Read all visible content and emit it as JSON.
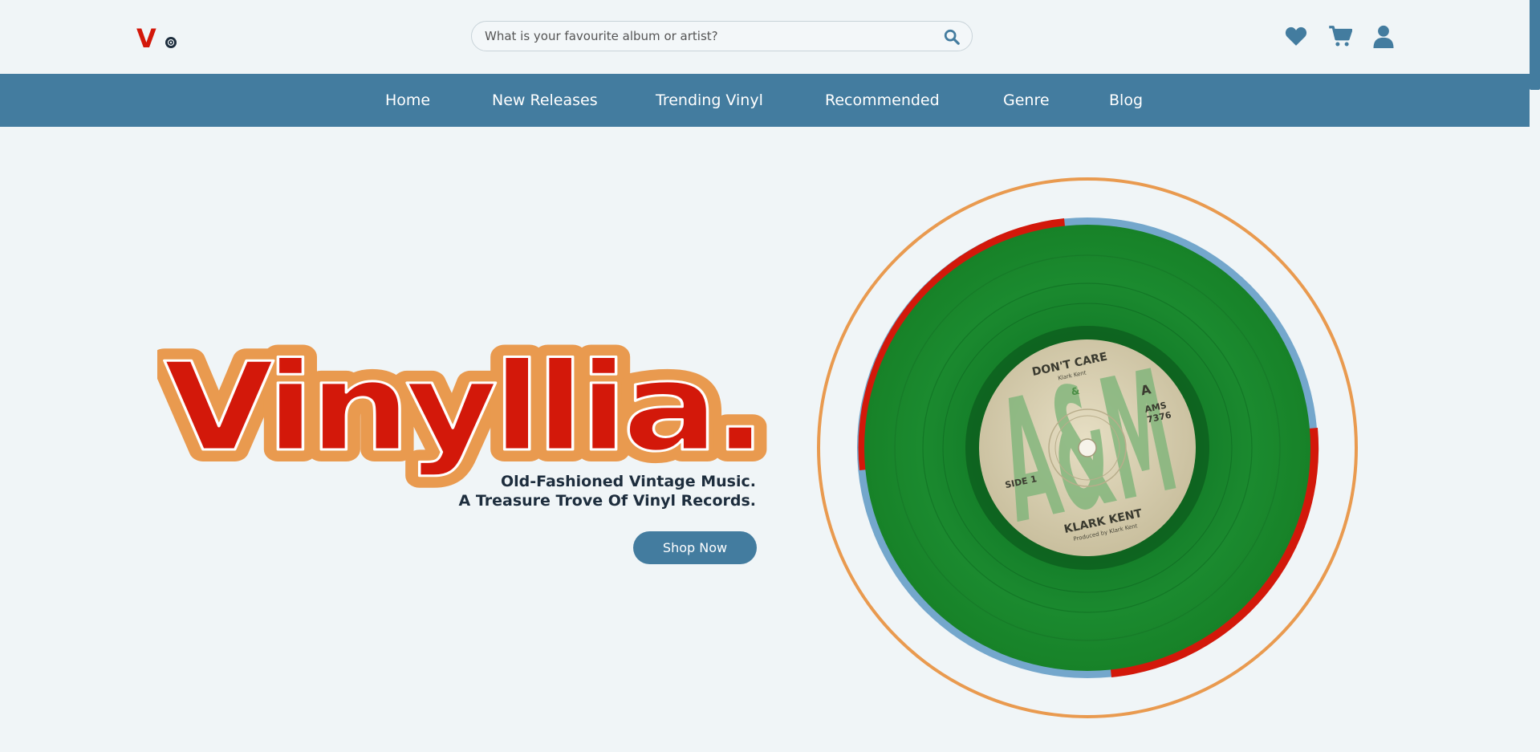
{
  "header": {
    "logo_letter": "V",
    "search": {
      "placeholder": "What is your favourite album or artist?",
      "value": ""
    },
    "icons": [
      "heart-icon",
      "cart-icon",
      "user-icon"
    ]
  },
  "nav": {
    "items": [
      {
        "label": "Home"
      },
      {
        "label": "New Releases"
      },
      {
        "label": "Trending Vinyl"
      },
      {
        "label": "Recommended"
      },
      {
        "label": "Genre"
      },
      {
        "label": "Blog"
      }
    ]
  },
  "hero": {
    "title": "Vinyllia.",
    "tagline_line1": "Old-Fashioned Vintage Music.",
    "tagline_line2": "A Treasure Trove Of Vinyl Records.",
    "cta_label": "Shop Now"
  },
  "record": {
    "title": "DON'T CARE",
    "artist_small": "Klark Kent",
    "ampersand": "&",
    "side": "A",
    "catalog": "AMS",
    "catalog_num": "7376",
    "side_label": "SIDE 1",
    "artist": "KLARK KENT",
    "producer": "Produced by Klark Kent",
    "brand": "A&M"
  },
  "colors": {
    "brand_blue": "#437c9f",
    "brand_red": "#d3180a",
    "brand_orange": "#e99a4f",
    "background": "#f0f5f7",
    "record_green": "#1b8a2f"
  }
}
